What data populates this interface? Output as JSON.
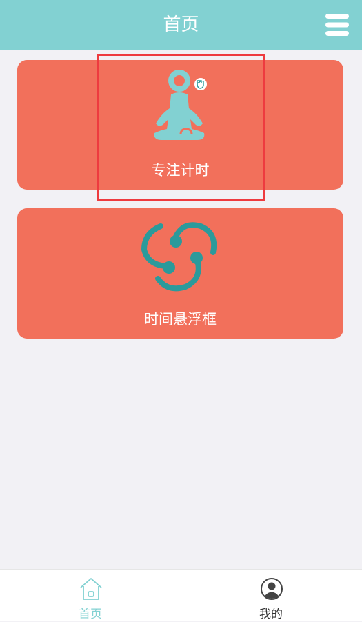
{
  "header": {
    "title": "首页",
    "menu_icon": "hamburger-menu-icon"
  },
  "cards": [
    {
      "label": "专注计时",
      "icon": "meditation-icon"
    },
    {
      "label": "时间悬浮框",
      "icon": "swirl-icon"
    }
  ],
  "tabbar": {
    "items": [
      {
        "label": "首页",
        "icon": "home-icon",
        "active": true
      },
      {
        "label": "我的",
        "icon": "user-icon",
        "active": false
      }
    ]
  },
  "colors": {
    "header_bg": "#82d1d2",
    "card_bg": "#f2705b",
    "icon_teal": "#82d1d2",
    "swirl_teal": "#2b9a9b",
    "highlight": "#ee3b3f",
    "page_bg": "#f2f1f5",
    "tab_active": "#82d1d2"
  }
}
